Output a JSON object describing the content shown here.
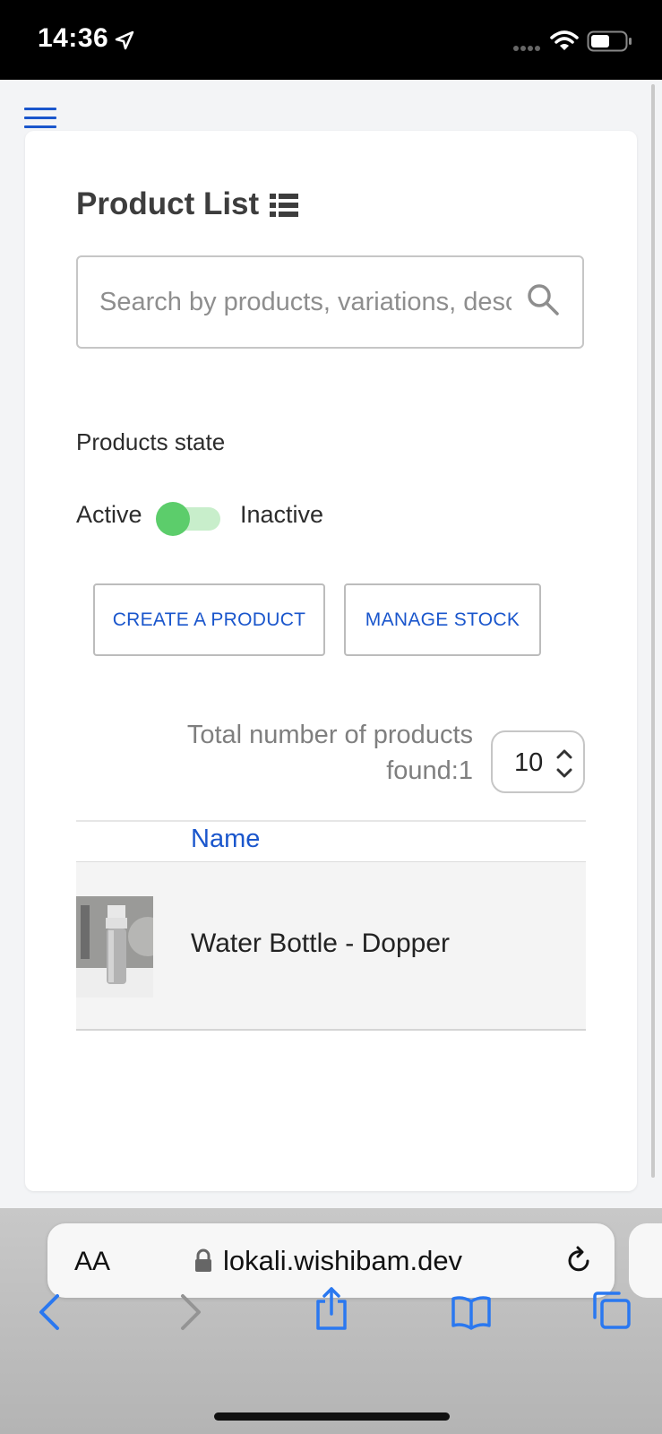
{
  "status_bar": {
    "time": "14:36"
  },
  "page": {
    "title": "Product List",
    "search": {
      "placeholder": "Search by products, variations, description",
      "value": ""
    },
    "state_label": "Products state",
    "toggle": {
      "left_label": "Active",
      "right_label": "Inactive",
      "state": "Active"
    },
    "buttons": {
      "create": "CREATE A PRODUCT",
      "stock": "MANAGE STOCK"
    },
    "total": {
      "line1": "Total number of products",
      "line2": "found:1"
    },
    "per_page": "10",
    "table": {
      "column": "Name",
      "rows": [
        {
          "name": "Water Bottle - Dopper"
        }
      ]
    }
  },
  "browser": {
    "text_size_label": "AA",
    "url": "lokali.wishibam.dev"
  },
  "colors": {
    "accent": "#1a56cc",
    "toggle_on": "#5ccd6b"
  }
}
